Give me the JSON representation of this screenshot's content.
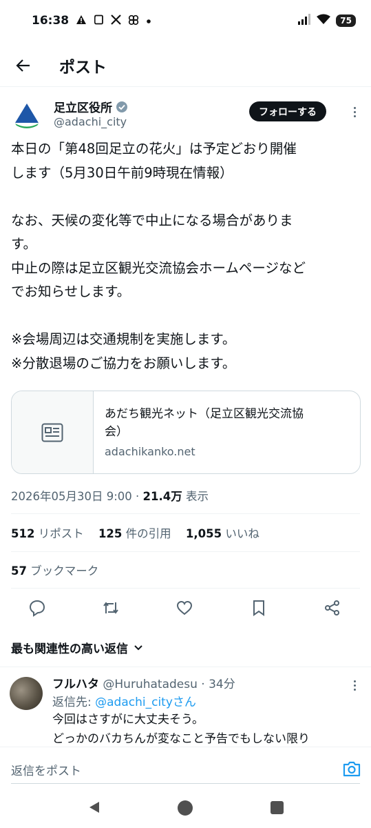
{
  "status_bar": {
    "time": "16:38",
    "icons": [
      "warning-icon",
      "square-icon",
      "x-logo-icon",
      "pinwheel-icon",
      "dot-icon"
    ],
    "battery": "75"
  },
  "top_bar": {
    "title": "ポスト"
  },
  "author": {
    "name": "足立区役所",
    "handle": "@adachi_city",
    "follow_label": "フォローする"
  },
  "tweet": {
    "lines": [
      "本日の「第48回足立の花火」は予定どおり開催",
      "します（5月30日午前9時現在情報）",
      "",
      "なお、天候の変化等で中止になる場合がありま",
      "す。",
      "中止の際は足立区観光交流協会ホームページなど",
      "でお知らせします。",
      "",
      "※会場周辺は交通規制を実施します。",
      "※分散退場のご協力をお願いします。"
    ]
  },
  "link_card": {
    "title_line1": "あだち観光ネット（足立区観光交流協",
    "title_line2": "会）",
    "domain": "adachikanko.net"
  },
  "meta": {
    "datetime": "2026年05月30日 9:00 · ",
    "views": "21.4万",
    "views_label": " 表示"
  },
  "stats": {
    "reposts": "512",
    "reposts_label": " リポスト",
    "quotes": "125",
    "quotes_label": " 件の引用",
    "likes": "1,055",
    "likes_label": " いいね",
    "bookmarks": "57",
    "bookmarks_label": " ブックマーク"
  },
  "actions": [
    "reply-icon",
    "repost-icon",
    "like-icon",
    "bookmark-icon",
    "share-icon"
  ],
  "sort": {
    "label": "最も関連性の高い返信"
  },
  "reply": {
    "name": "フルハタ",
    "handle_time": " @Huruhatadesu · 34分",
    "reply_to_prefix": "返信先: ",
    "reply_to_handle": "@adachi_cityさん",
    "line1": "今回はさすがに大丈夫そう。",
    "line2": "どっかのバカちんが変なこと予告でもしない限り"
  },
  "compose": {
    "placeholder": "返信をポスト"
  },
  "colors": {
    "accent": "#1d9bf0",
    "text_primary": "#0f1419",
    "text_secondary": "#536471",
    "verified": "#829aab"
  }
}
